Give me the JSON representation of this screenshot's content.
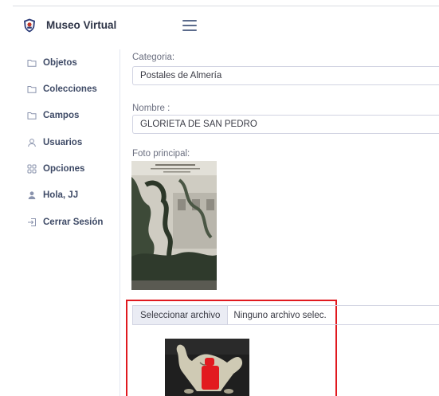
{
  "app": {
    "brand": "Museo Virtual",
    "logo_icon": "shield-icon",
    "menu_icon": "hamburger-icon"
  },
  "sidebar": {
    "items": [
      {
        "label": "Objetos",
        "icon": "folder-icon"
      },
      {
        "label": "Colecciones",
        "icon": "folder-icon"
      },
      {
        "label": "Campos",
        "icon": "folder-icon"
      },
      {
        "label": "Usuarios",
        "icon": "user-icon"
      },
      {
        "label": "Opciones",
        "icon": "grid-icon"
      },
      {
        "label": "Hola, JJ",
        "icon": "user-filled-icon"
      },
      {
        "label": "Cerrar Sesión",
        "icon": "logout-icon"
      }
    ]
  },
  "form": {
    "categoria_label": "Categoria:",
    "categoria_value": "Postales de Almería",
    "nombre_label": "Nombre :",
    "nombre_value": "GLORIETA DE SAN PEDRO",
    "foto_label": "Foto principal:",
    "file_button": "Seleccionar archivo",
    "file_status": "Ninguno archivo selec."
  },
  "colors": {
    "accent_red": "#e0191f",
    "text_dark": "#3e4a66",
    "border": "#d1d3e2"
  }
}
